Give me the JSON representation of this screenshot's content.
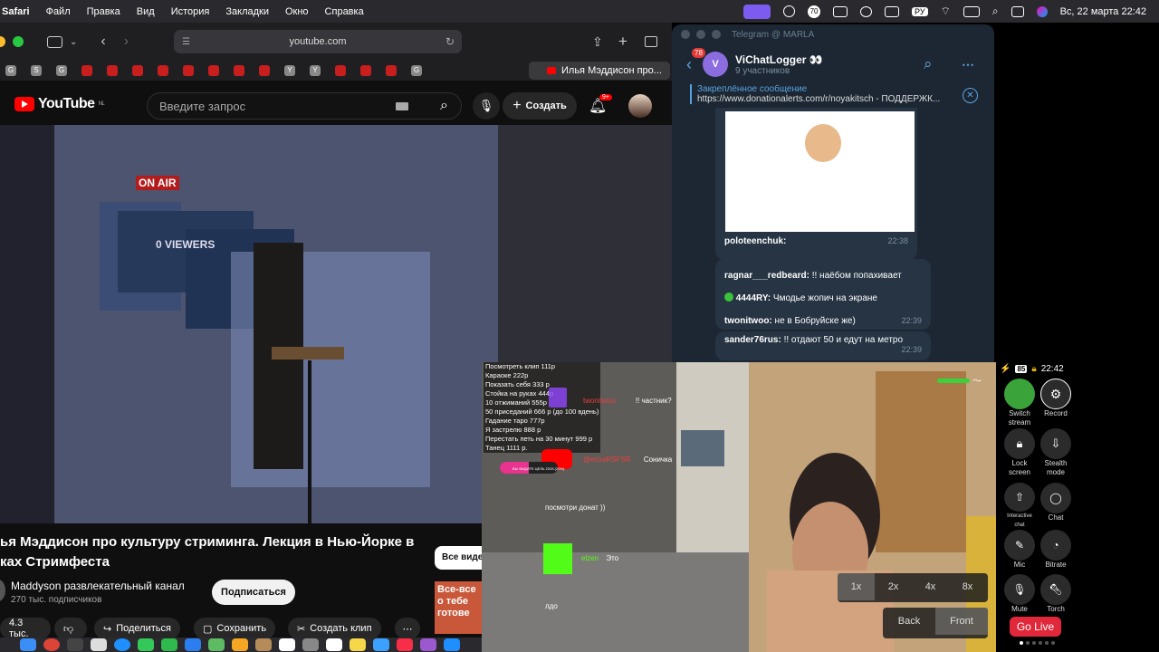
{
  "menubar": {
    "app": "Safari",
    "items": [
      "Файл",
      "Правка",
      "Вид",
      "История",
      "Закладки",
      "Окно",
      "Справка"
    ],
    "datetime": "Вс, 22 марта  22:42",
    "badge_count": "70"
  },
  "safari": {
    "url": "youtube.com",
    "active_tab": "Илья Мэддисон про...",
    "fav_letters": [
      "G",
      "S",
      "G",
      "Y",
      "Y",
      "G"
    ]
  },
  "youtube": {
    "logo": "YouTube",
    "region": "NL",
    "search_placeholder": "Введите запрос",
    "create_label": "Создать",
    "notif_count": "9+",
    "video_title": "ья Мэддисон про культуру стриминга. Лекция в Нью-Йорке в\nках Стримфеста",
    "video_overlay_onair": "ON AIR",
    "video_overlay_viewers": "0 VIEWERS",
    "channel_name": "Maddyson развлекательный канал",
    "subscribers": "270 тыс. подписчиков",
    "subscribe_label": "Подписаться",
    "see_all": "Все видео",
    "actions": {
      "likes": "4.3 тыс.",
      "share": "Поделиться",
      "save": "Сохранить",
      "clip": "Создать клип"
    },
    "related_thumb": "Все-все\nо тебе\nготове"
  },
  "telegram": {
    "window_title": "Telegram @ MARLA",
    "back_badge": "78",
    "avatar_letter": "V",
    "chat_name": "ViChatLogger 👀",
    "members": "9 участников",
    "pinned_label": "Закреплённое сообщение",
    "pinned_text": "https://www.donationalerts.com/r/noyakitsch - ПОДДЕРЖК...",
    "messages": [
      {
        "author": "poloteenchuk:",
        "text": "",
        "time": "22:38"
      },
      {
        "author": "ragnar___redbeard:",
        "text": "!! наёбом попахивает",
        "time": ""
      },
      {
        "author": "4444RY:",
        "text": "Чмодье жопич на экране",
        "time": ""
      },
      {
        "author": "twonitwoo:",
        "text": "не в Бобруйске же)",
        "time": "22:39"
      },
      {
        "author": "sander76rus:",
        "text": "!! отдают 50 и едут на метро",
        "time": "22:39"
      }
    ]
  },
  "stream": {
    "donation_menu": [
      "Посмотреть клип 111р",
      "Караоке 222р",
      "Показать себя 333 р",
      "Стойка на руках 444р",
      "10 отжиманий 555р",
      "50 приседаний 666 р (до 100 вдень)",
      "Гадание таро 777р",
      "Я застрелю 888 р",
      "Перестать петь на 30 минут 999 р",
      "Танец 1111 р."
    ],
    "chat_overlay": [
      {
        "user": "twonitwoo",
        "text": "!! частник?"
      },
      {
        "user": "@erizaRSFSR",
        "text": "Соничка"
      },
      {
        "user": "",
        "text": "посмотри донат ))"
      },
      {
        "user": "elzen",
        "text": "Это"
      },
      {
        "user": "",
        "text": "лдо"
      }
    ],
    "progress_label": "ВЫ ВИДИТЕ ЦЕЛЬ 2025 (20%)",
    "zoom_options": [
      "1x",
      "2x",
      "4x",
      "8x"
    ],
    "camera_options": [
      "Back",
      "Front"
    ]
  },
  "rpanel": {
    "battery": "85",
    "time": "22:42",
    "buttons": [
      {
        "label": "Switch stream",
        "icon": "pepe-icon"
      },
      {
        "label": "Record",
        "icon": "gear-icon"
      },
      {
        "label": "Lock screen",
        "icon": "lock-icon"
      },
      {
        "label": "Stealth mode",
        "icon": "stealth-icon"
      },
      {
        "label": "Interactive chat",
        "icon": "upload-icon"
      },
      {
        "label": "Chat",
        "icon": "chat-bubble-icon"
      },
      {
        "label": "Mic",
        "icon": "mic-off-icon"
      },
      {
        "label": "Bitrate",
        "icon": "gauge-icon"
      },
      {
        "label": "Mute",
        "icon": "mic-icon"
      },
      {
        "label": "Torch",
        "icon": "torch-icon"
      }
    ],
    "go_live": "Go Live"
  },
  "colors": {
    "yt_red": "#ff0000",
    "tg_bg": "#1c2733",
    "go_live": "#e0283a",
    "accent": "#5aa4e0"
  }
}
